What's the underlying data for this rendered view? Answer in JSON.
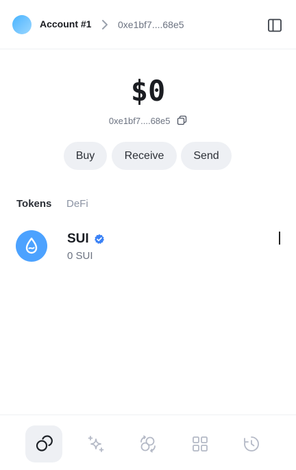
{
  "header": {
    "account_name": "Account #1",
    "address_short": "0xe1bf7....68e5"
  },
  "wallet": {
    "balance": "$0",
    "address_short": "0xe1bf7....68e5"
  },
  "actions": {
    "buy": "Buy",
    "receive": "Receive",
    "send": "Send"
  },
  "tabs": {
    "tokens": "Tokens",
    "defi": "DeFi",
    "active": "Tokens"
  },
  "tokens": [
    {
      "symbol": "SUI",
      "amount": "0 SUI",
      "verified": true,
      "logo_color": "#4ca2ff"
    }
  ],
  "nav": {
    "items": [
      {
        "icon": "coins-icon",
        "active": true
      },
      {
        "icon": "sparkles-icon",
        "active": false
      },
      {
        "icon": "swap-icon",
        "active": false
      },
      {
        "icon": "apps-grid-icon",
        "active": false
      },
      {
        "icon": "history-icon",
        "active": false
      }
    ]
  },
  "colors": {
    "accent": "#4ca2ff",
    "verified_badge": "#3b82f6",
    "button_bg": "#eef0f4",
    "muted_text": "#6b7280",
    "inactive_icon": "#b4b9c6"
  }
}
